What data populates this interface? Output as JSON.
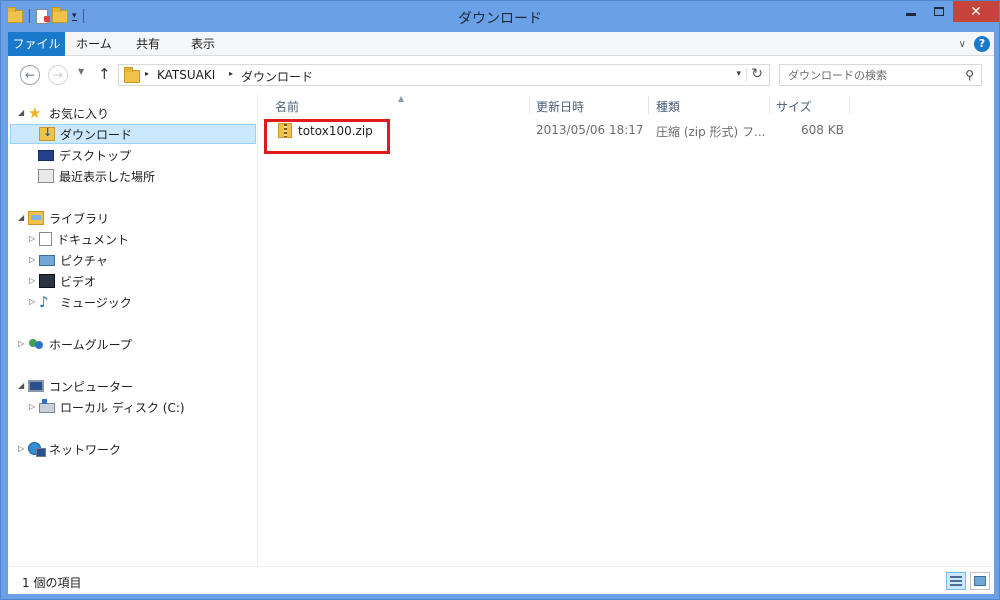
{
  "window": {
    "title": "ダウンロード",
    "min_glyph": "—",
    "max_glyph": "□",
    "close_glyph": "✕",
    "qat_dropdown_glyph": "▾"
  },
  "ribbon": {
    "tabs": [
      "ファイル",
      "ホーム",
      "共有",
      "表示"
    ],
    "collapse_glyph": "∨",
    "help_glyph": "?"
  },
  "nav": {
    "back_glyph": "←",
    "forward_glyph": "→",
    "recent_glyph": "▼",
    "up_glyph": "↑",
    "breadcrumb": [
      "KATSUAKI",
      "ダウンロード"
    ],
    "crumb_sep": "▸",
    "dropdown_glyph": "▾",
    "refresh_glyph": "↻",
    "search_placeholder": "ダウンロードの検索",
    "search_glyph": "⚲"
  },
  "sidebar": {
    "expanded_glyph": "◢",
    "collapsed_glyph": "▷",
    "favorites": {
      "label": "お気に入り",
      "items": [
        "ダウンロード",
        "デスクトップ",
        "最近表示した場所"
      ]
    },
    "libraries": {
      "label": "ライブラリ",
      "items": [
        "ドキュメント",
        "ピクチャ",
        "ビデオ",
        "ミュージック"
      ]
    },
    "homegroup": {
      "label": "ホームグループ"
    },
    "computer": {
      "label": "コンピューター",
      "items": [
        "ローカル ディスク (C:)"
      ]
    },
    "network": {
      "label": "ネットワーク"
    },
    "star_glyph": "★",
    "music_glyph": "♪"
  },
  "files": {
    "columns": [
      "名前",
      "更新日時",
      "種類",
      "サイズ"
    ],
    "sort_glyph": "▲",
    "rows": [
      {
        "name": "totox100.zip",
        "modified": "2013/05/06 18:17",
        "type": "圧縮 (zip 形式) フ...",
        "size": "608 KB"
      }
    ]
  },
  "status": {
    "count": "1 個の項目"
  },
  "colors": {
    "accent": "#1979ca",
    "selection": "#cce8ff",
    "highlight_box": "#e01b1b",
    "frame": "#6aa0e6"
  }
}
